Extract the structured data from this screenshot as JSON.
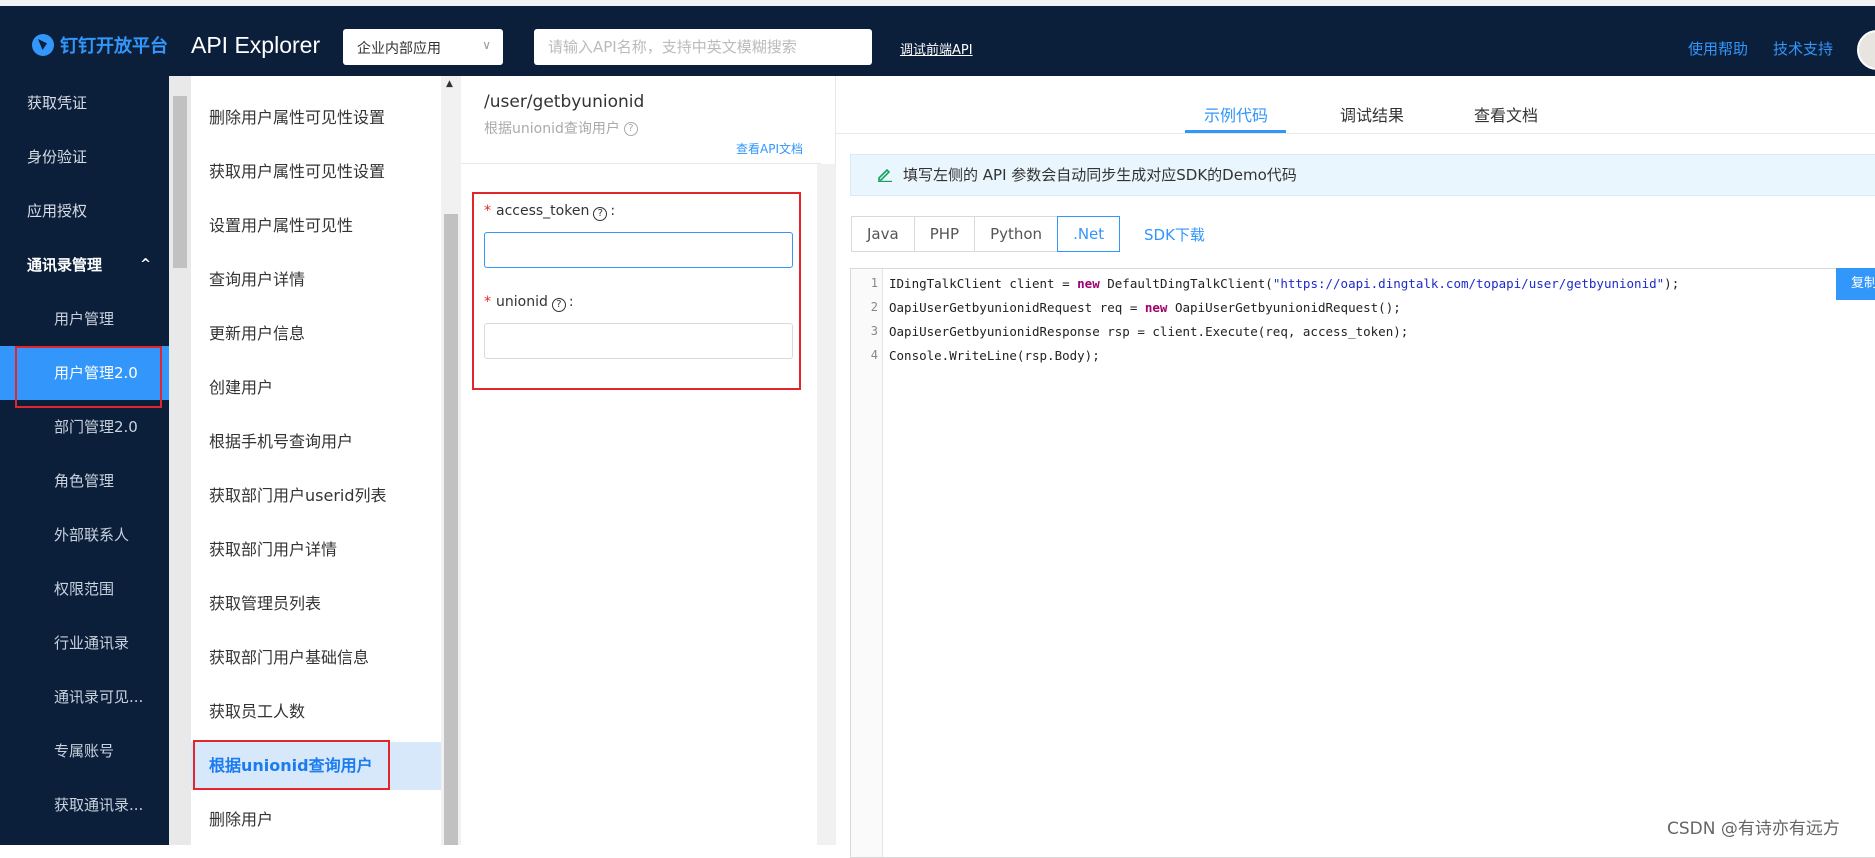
{
  "header": {
    "brand": "钉钉开放平台",
    "app_title": "API Explorer",
    "app_select": "企业内部应用",
    "search_placeholder": "请输入API名称，支持中英文模糊搜索",
    "frontend_link": "调试前端API",
    "help": "使用帮助",
    "support": "技术支持"
  },
  "left_nav": {
    "items": [
      {
        "label": "获取凭证"
      },
      {
        "label": "身份验证"
      },
      {
        "label": "应用授权"
      },
      {
        "label": "通讯录管理",
        "caret": "^"
      },
      {
        "label": "用户管理"
      },
      {
        "label": "用户管理2.0"
      },
      {
        "label": "部门管理2.0"
      },
      {
        "label": "角色管理"
      },
      {
        "label": "外部联系人"
      },
      {
        "label": "权限范围"
      },
      {
        "label": "行业通讯录"
      },
      {
        "label": "通讯录可见..."
      },
      {
        "label": "专属账号"
      },
      {
        "label": "获取通讯录..."
      }
    ]
  },
  "api_list": {
    "items": [
      {
        "label": "删除用户属性可见性设置"
      },
      {
        "label": "获取用户属性可见性设置"
      },
      {
        "label": "设置用户属性可见性"
      },
      {
        "label": "查询用户详情"
      },
      {
        "label": "更新用户信息"
      },
      {
        "label": "创建用户"
      },
      {
        "label": "根据手机号查询用户"
      },
      {
        "label": "获取部门用户userid列表"
      },
      {
        "label": "获取部门用户详情"
      },
      {
        "label": "获取管理员列表"
      },
      {
        "label": "获取部门用户基础信息"
      },
      {
        "label": "获取员工人数"
      },
      {
        "label": "根据unionid查询用户"
      },
      {
        "label": "删除用户"
      }
    ]
  },
  "params": {
    "path": "/user/getbyunionid",
    "desc": "根据unionid查询用户",
    "doc_link": "查看API文档",
    "fields": [
      {
        "name": "access_token",
        "value": ""
      },
      {
        "name": "unionid",
        "value": ""
      }
    ]
  },
  "right": {
    "tabs": [
      "示例代码",
      "调试结果",
      "查看文档"
    ],
    "notice": "填写左侧的 API 参数会自动同步生成对应SDK的Demo代码",
    "langs": [
      "Java",
      "PHP",
      "Python",
      ".Net"
    ],
    "sdk_link": "SDK下载",
    "copy": "复制",
    "code": [
      {
        "no": "1",
        "a": "IDingTalkClient client = ",
        "kw": "new",
        "b": " DefaultDingTalkClient(",
        "str": "\"https://oapi.dingtalk.com/topapi/user/getbyunionid\"",
        "c": ");"
      },
      {
        "no": "2",
        "a": "OapiUserGetbyunionidRequest req = ",
        "kw": "new",
        "b": " OapiUserGetbyunionidRequest();",
        "str": "",
        "c": ""
      },
      {
        "no": "3",
        "a": "OapiUserGetbyunionidResponse rsp = client.Execute(req, access_token);",
        "kw": "",
        "b": "",
        "str": "",
        "c": ""
      },
      {
        "no": "4",
        "a": "Console.WriteLine(rsp.Body);",
        "kw": "",
        "b": "",
        "str": "",
        "c": ""
      }
    ]
  },
  "watermark": "CSDN @有诗亦有远方"
}
